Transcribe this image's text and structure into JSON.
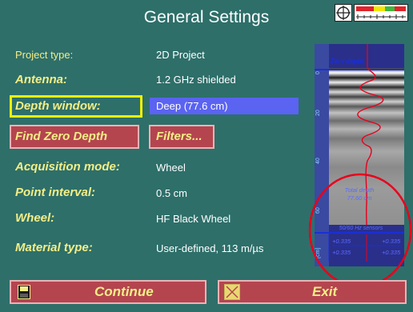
{
  "header": {
    "title": "General Settings"
  },
  "fields": {
    "project_type_label": "Project type:",
    "project_type_value": "2D Project",
    "antenna_label": "Antenna:",
    "antenna_value": "1.2 GHz shielded",
    "depth_window_label": "Depth window:",
    "depth_window_value": "Deep (77.6 cm)",
    "acquisition_mode_label": "Acquisition mode:",
    "acquisition_mode_value": "Wheel",
    "point_interval_label": "Point interval:",
    "point_interval_value": "0.5 cm",
    "wheel_label": "Wheel:",
    "wheel_value": "HF Black Wheel",
    "material_type_label": "Material type:",
    "material_type_value": "User-defined, 113 m/µs"
  },
  "buttons": {
    "find_zero_depth": "Find Zero Depth",
    "filters": "Filters...",
    "continue": "Continue",
    "exit": "Exit"
  },
  "radar_preview": {
    "zero_depth_label": "Zero depth",
    "total_depth_label": "Total depth",
    "total_depth_value": "77.60 cm",
    "sensors_label": "50/60 Hz sensors",
    "sensor_values": [
      "+0.335",
      "+0.335",
      "+0.335",
      "+0.335"
    ],
    "depth_ticks": [
      "0",
      "20",
      "40",
      "60"
    ],
    "unit_label": "[cm]"
  },
  "icons": {
    "crosshair": "crosshair-icon",
    "scale_bar": "level-meter-icon",
    "continue": "save-disk-icon",
    "exit": "close-x-icon"
  },
  "colors": {
    "background": "#2e6f6a",
    "label_yellow": "#f3ee86",
    "button_red": "#b4454f",
    "highlight_yellow": "#f2f000",
    "selected_blue": "#5b63f1",
    "annotation_red": "#e8001c"
  }
}
